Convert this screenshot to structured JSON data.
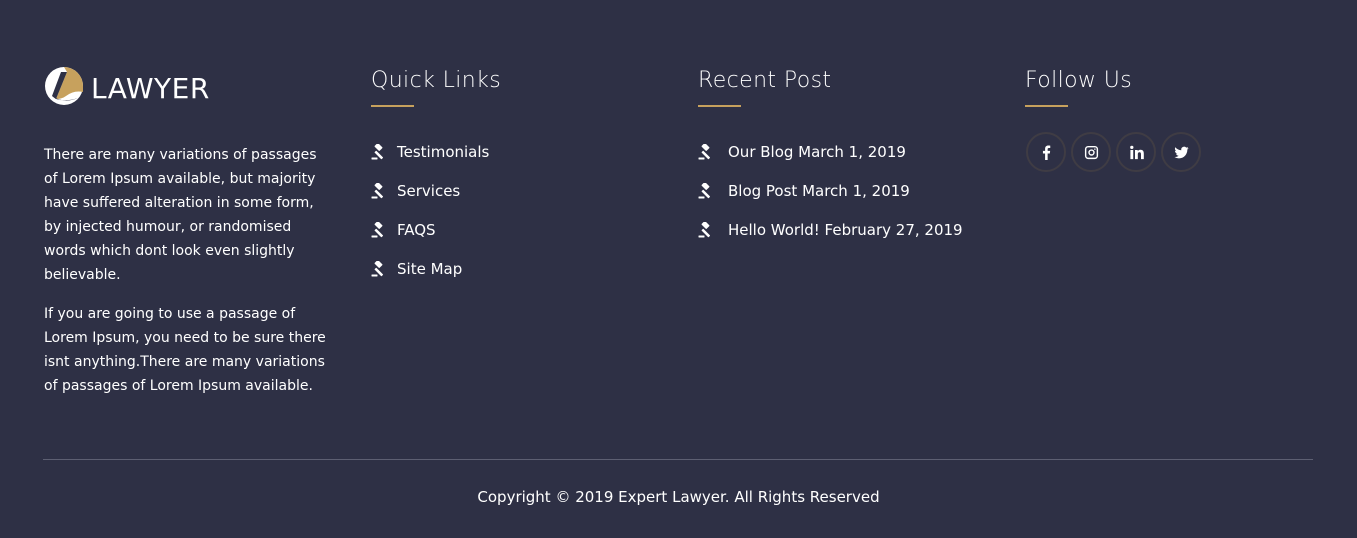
{
  "brand": {
    "name": "LAWYER",
    "accent_color": "#c7a15d",
    "background_color": "#2e3045"
  },
  "about": {
    "paragraphs": [
      "There are many variations of passages of Lorem Ipsum available, but majority have suffered alteration in some form, by injected humour, or randomised words which dont look even slightly believable.",
      "If you are going to use a passage of Lorem Ipsum, you need to be sure there isnt anything.There are many variations of passages of Lorem Ipsum available."
    ]
  },
  "quick_links": {
    "heading": "Quick Links",
    "items": [
      {
        "label": "Testimonials",
        "icon": "gavel-icon"
      },
      {
        "label": "Services",
        "icon": "gavel-icon"
      },
      {
        "label": "FAQS",
        "icon": "gavel-icon"
      },
      {
        "label": "Site Map",
        "icon": "gavel-icon"
      }
    ]
  },
  "recent_posts": {
    "heading": "Recent Post",
    "items": [
      {
        "label": "Our Blog March 1, 2019",
        "icon": "gavel-icon"
      },
      {
        "label": "Blog Post March 1, 2019",
        "icon": "gavel-icon"
      },
      {
        "label": "Hello World! February 27, 2019",
        "icon": "gavel-icon"
      }
    ]
  },
  "follow_us": {
    "heading": "Follow Us",
    "socials": [
      {
        "icon": "facebook-icon"
      },
      {
        "icon": "instagram-icon"
      },
      {
        "icon": "linkedin-icon"
      },
      {
        "icon": "twitter-icon"
      }
    ]
  },
  "footer": {
    "copyright": "Copyright © 2019 Expert Lawyer. All Rights Reserved"
  }
}
